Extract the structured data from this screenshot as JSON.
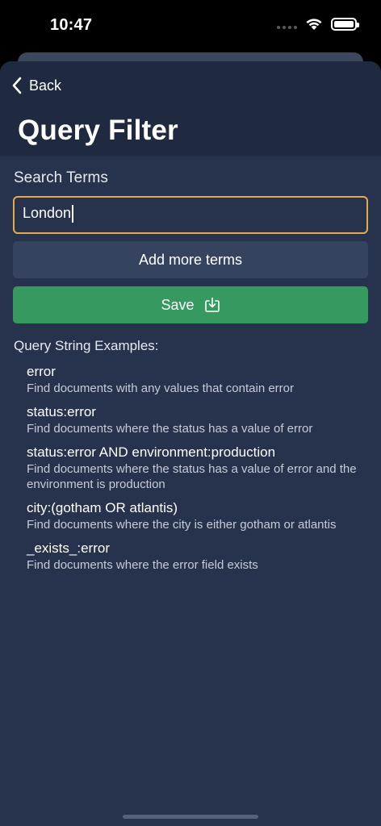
{
  "status_bar": {
    "time": "10:47"
  },
  "nav": {
    "back_label": "Back",
    "title": "Query Filter"
  },
  "search": {
    "label": "Search Terms",
    "value": "London"
  },
  "buttons": {
    "add_more": "Add more terms",
    "save": "Save"
  },
  "examples": {
    "heading": "Query String Examples:",
    "items": [
      {
        "query": "error",
        "description": "Find documents with any values that contain error"
      },
      {
        "query": "status:error",
        "description": "Find documents where the status has a value of error"
      },
      {
        "query": "status:error AND environment:production",
        "description": "Find documents where the status has a value of error and the environment is production"
      },
      {
        "query": "city:(gotham OR atlantis)",
        "description": "Find documents where the city is either gotham or atlantis"
      },
      {
        "query": "_exists_:error",
        "description": "Find documents where the error field exists"
      }
    ]
  },
  "colors": {
    "background": "#27334d",
    "header": "#1f2a40",
    "input_border": "#e8a948",
    "save_button": "#36995f",
    "secondary_button": "#36435f"
  },
  "icons": {
    "back": "chevron-left-icon",
    "save": "download-tray-icon",
    "wifi": "wifi-icon",
    "battery": "battery-icon",
    "signal": "cellular-signal-icon"
  }
}
